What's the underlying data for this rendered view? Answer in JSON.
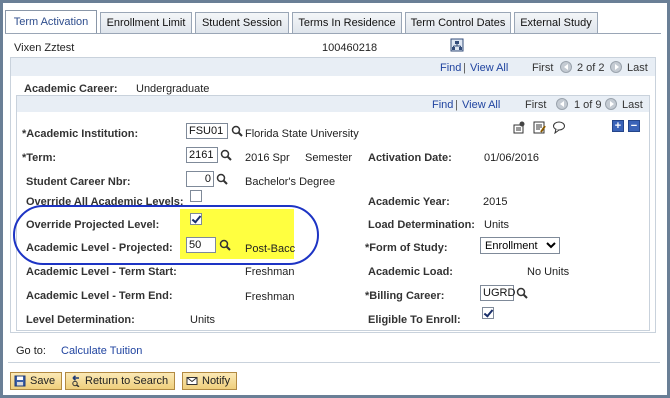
{
  "tabs": [
    {
      "label": "Term Activation"
    },
    {
      "label": "Enrollment Limit"
    },
    {
      "label": "Student Session"
    },
    {
      "label": "Terms In Residence"
    },
    {
      "label": "Term Control Dates"
    },
    {
      "label": "External Study"
    }
  ],
  "header": {
    "name": "Vixen Zztest",
    "id": "100460218"
  },
  "outer_nav": {
    "find": "Find",
    "sep": "|",
    "view_all": "View All",
    "first": "First",
    "count": "2 of 2",
    "last": "Last"
  },
  "career": {
    "label": "Academic Career:",
    "value": "Undergraduate"
  },
  "inner_nav": {
    "find": "Find",
    "sep": "|",
    "view_all": "View All",
    "first": "First",
    "count": "1 of 9",
    "last": "Last"
  },
  "fields": {
    "institution": {
      "label": "*Academic Institution:",
      "code": "FSU01",
      "desc": "Florida State University"
    },
    "term": {
      "label": "*Term:",
      "code": "2161",
      "desc": "2016 Spr",
      "type": "Semester"
    },
    "activation_date": {
      "label": "Activation Date:",
      "value": "01/06/2016"
    },
    "career_nbr": {
      "label": "Student Career Nbr:",
      "value": "0",
      "desc": "Bachelor's Degree"
    },
    "override_all": {
      "label": "Override All Academic Levels:"
    },
    "academic_year": {
      "label": "Academic Year:",
      "value": "2015"
    },
    "override_projected": {
      "label": "Override Projected Level:"
    },
    "load_determination": {
      "label": "Load Determination:",
      "value": "Units"
    },
    "level_projected": {
      "label": "Academic Level - Projected:",
      "code": "50",
      "desc": "Post-Bacc"
    },
    "form_of_study": {
      "label": "*Form of Study:",
      "value": "Enrollment"
    },
    "level_term_start": {
      "label": "Academic Level - Term Start:",
      "value": "Freshman"
    },
    "academic_load": {
      "label": "Academic Load:",
      "value": "No Units"
    },
    "level_term_end": {
      "label": "Academic Level - Term End:",
      "value": "Freshman"
    },
    "billing_career": {
      "label": "*Billing Career:",
      "value": "UGRD"
    },
    "level_determination": {
      "label": "Level Determination:",
      "value": "Units"
    },
    "eligible": {
      "label": "Eligible To Enroll:"
    }
  },
  "goto": {
    "label": "Go to:",
    "link": "Calculate Tuition"
  },
  "buttons": {
    "save": "Save",
    "return": "Return to Search",
    "notify": "Notify"
  },
  "checkboxes": {
    "override_all": false,
    "override_projected": true,
    "eligible": true
  },
  "colors": {
    "highlight": "#ffff40",
    "oval": "#1d34c4",
    "link": "#2044a0"
  }
}
